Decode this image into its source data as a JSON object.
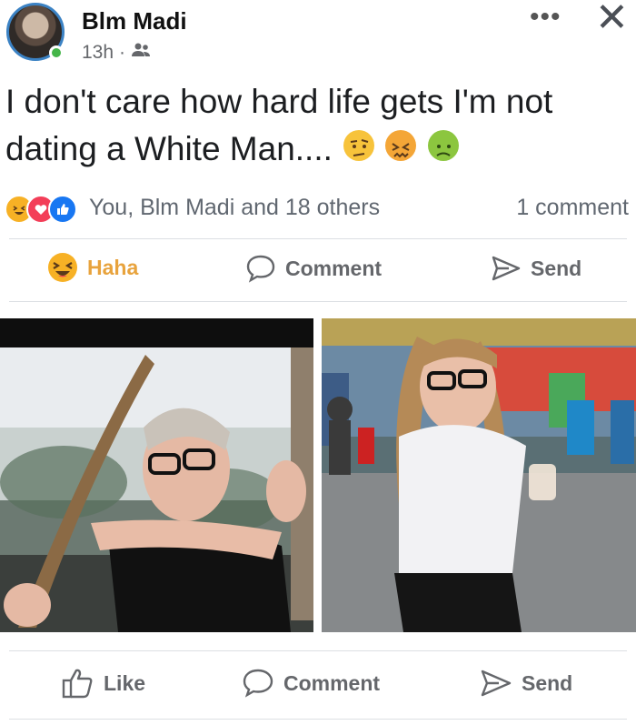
{
  "post": {
    "author": "Blm Madi",
    "time": "13h",
    "separator": "·",
    "text_line1": "I don't care how hard life gets I'm not",
    "text_line2": "dating a White Man...."
  },
  "reactions": {
    "summary": "You, Blm Madi and 18 others",
    "comments": "1 comment"
  },
  "reaction_bar": {
    "haha_label": "Haha",
    "comment_label": "Comment",
    "send_label": "Send"
  },
  "bottom_bar": {
    "like_label": "Like",
    "comment_label": "Comment",
    "send_label": "Send"
  },
  "colors": {
    "like_blue": "#1877f2",
    "love_red": "#f33e58",
    "haha_yellow": "#f7b125",
    "haha_text": "#e8a33d",
    "muted": "#65676b",
    "online_green": "#44b549"
  },
  "icons": [
    "more-icon",
    "close-icon",
    "friends-icon",
    "haha-icon",
    "love-icon",
    "like-icon",
    "comment-icon",
    "send-icon",
    "like-thumb-icon"
  ]
}
